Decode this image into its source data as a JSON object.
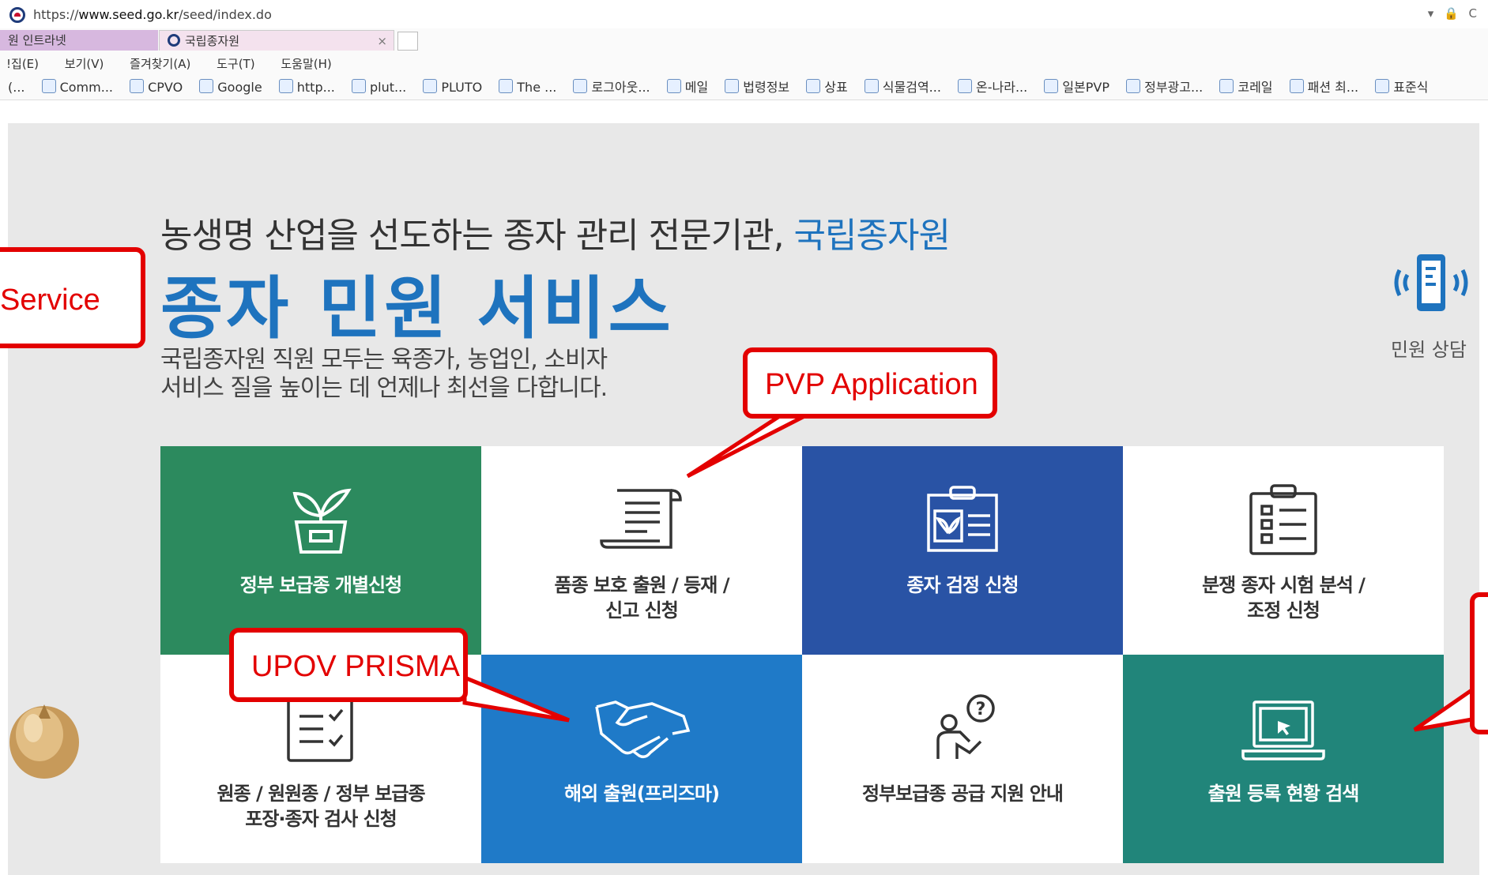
{
  "browser": {
    "url_prefix": "https://",
    "url_host": "www.seed.go.kr",
    "url_path": "/seed/index.do",
    "controls": "▾ 🔒 C",
    "tabs": [
      {
        "label": "원 인트라넷"
      },
      {
        "label": "국립종자원",
        "close": "×"
      }
    ],
    "menu": [
      "!집(E)",
      "보기(V)",
      "즐겨찾기(A)",
      "도구(T)",
      "도움말(H)"
    ],
    "favorites": [
      "(...",
      "Comm...",
      "CPVO",
      "Google",
      "http...",
      "plut...",
      "PLUTO",
      "The ...",
      "로그아웃...",
      "메일",
      "법령정보",
      "상표",
      "식물검역...",
      "온-나라...",
      "일본PVP",
      "정부광고...",
      "코레일",
      "패션 최...",
      "표준식"
    ]
  },
  "hero": {
    "subtitle_main": "농생명 산업을 선도하는 종자 관리 전문기관, ",
    "subtitle_highlight": "국립종자원",
    "title": "종자 민원 서비스",
    "desc_line1": "국립종자원 직원 모두는 육종가, 농업인, 소비자",
    "desc_line2": "서비스 질을 높이는 데 언제나 최선을 다합니다."
  },
  "side": {
    "label": "민원 상담",
    "icon": "mobile-phone-icon"
  },
  "tiles": [
    {
      "label": "정부 보급종 개별신청",
      "icon": "plant-pot-icon"
    },
    {
      "label_line1": "품종 보호 출원 / 등재 /",
      "label_line2": "신고 신청",
      "icon": "scroll-document-icon"
    },
    {
      "label": "종자 검정 신청",
      "icon": "clipboard-plant-icon"
    },
    {
      "label_line1": "분쟁 종자 시험 분석 /",
      "label_line2": "조정 신청",
      "icon": "checklist-clipboard-icon"
    },
    {
      "label_line1": "원종 / 원원종 / 정부 보급종",
      "label_line2": "포장·종자 검사 신청",
      "icon": "inspection-list-icon"
    },
    {
      "label": "해외 출원(프리즈마)",
      "icon": "handshake-icon"
    },
    {
      "label": "정부보급종 공급 지원 안내",
      "icon": "question-person-icon"
    },
    {
      "label": "출원 등록 현황 검색",
      "icon": "laptop-icon"
    }
  ],
  "callouts": {
    "service": "Service",
    "pvp": "PVP Application",
    "upov": "UPOV PRISMA"
  },
  "colors": {
    "accent_blue": "#1e73be",
    "tile_green": "#2c8a5e",
    "tile_navy": "#2953a5",
    "tile_blue": "#1f7ac8",
    "tile_teal": "#21857a",
    "callout_red": "#e30000"
  }
}
